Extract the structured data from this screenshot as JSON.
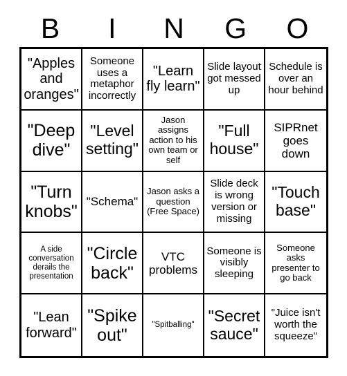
{
  "header": {
    "letters": [
      "B",
      "I",
      "N",
      "G",
      "O"
    ]
  },
  "grid": {
    "rows": 5,
    "columns": 5,
    "free_space_index": 12,
    "border_color": "#000000",
    "background_color": "#ffffff",
    "cells": [
      {
        "text": "\"Apples and oranges\"",
        "size": "l"
      },
      {
        "text": "Someone uses a metaphor incorrectly",
        "size": "s"
      },
      {
        "text": "\"Learn fly learn\"",
        "size": "l"
      },
      {
        "text": "Slide layout got messed up",
        "size": "s"
      },
      {
        "text": "Schedule is over an hour behind",
        "size": "s"
      },
      {
        "text": "\"Deep dive\"",
        "size": "xxl"
      },
      {
        "text": "\"Level setting\"",
        "size": "xl"
      },
      {
        "text": "Jason assigns action to his own team or self",
        "size": "xs"
      },
      {
        "text": "\"Full house\"",
        "size": "xl"
      },
      {
        "text": "SIPRnet goes down",
        "size": "m"
      },
      {
        "text": "\"Turn knobs\"",
        "size": "xxl"
      },
      {
        "text": "\"Schema\"",
        "size": "m"
      },
      {
        "text": "Jason asks a question (Free Space)",
        "size": "xs"
      },
      {
        "text": "Slide deck is wrong version or missing",
        "size": "s"
      },
      {
        "text": "\"Touch base\"",
        "size": "xl"
      },
      {
        "text": "A side conversation derails the presentation",
        "size": "xxs"
      },
      {
        "text": "\"Circle back\"",
        "size": "xxl"
      },
      {
        "text": "VTC problems",
        "size": "m"
      },
      {
        "text": "Someone is visibly sleeping",
        "size": "s"
      },
      {
        "text": "Someone asks presenter to go back",
        "size": "xs"
      },
      {
        "text": "\"Lean forward\"",
        "size": "l"
      },
      {
        "text": "\"Spike out\"",
        "size": "xxl"
      },
      {
        "text": "\"Spitballing\"",
        "size": "xxs"
      },
      {
        "text": "\"Secret sauce\"",
        "size": "xl"
      },
      {
        "text": "\"Juice isn't worth the squeeze\"",
        "size": "s"
      }
    ]
  }
}
